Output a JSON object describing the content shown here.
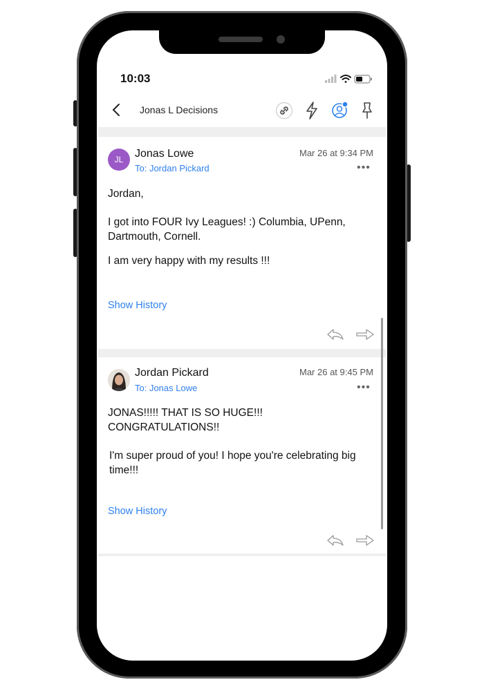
{
  "status_bar": {
    "time": "10:03"
  },
  "header": {
    "title": "Jonas L Decisions"
  },
  "messages": [
    {
      "initials": "JL",
      "avatar_color": "#9b59c7",
      "sender": "Jonas Lowe",
      "to": "To: Jordan Pickard",
      "date": "Mar 26 at 9:34 PM",
      "greeting": "Jordan,",
      "para1": "I got into FOUR Ivy Leagues! :) Columbia, UPenn, Dartmouth, Cornell.",
      "para2": "I am very happy with my results !!!",
      "show_history": "Show History"
    },
    {
      "sender": "Jordan Pickard",
      "to": "To: Jonas Lowe",
      "date": "Mar 26 at 9:45 PM",
      "greeting": "JONAS!!!!! THAT IS SO HUGE!!! CONGRATULATIONS!!",
      "para1": "I'm super proud of you! I hope you're celebrating big time!!!",
      "show_history": "Show History"
    }
  ],
  "colors": {
    "accent": "#2f80ed",
    "avatar_purple": "#9b59c7"
  }
}
